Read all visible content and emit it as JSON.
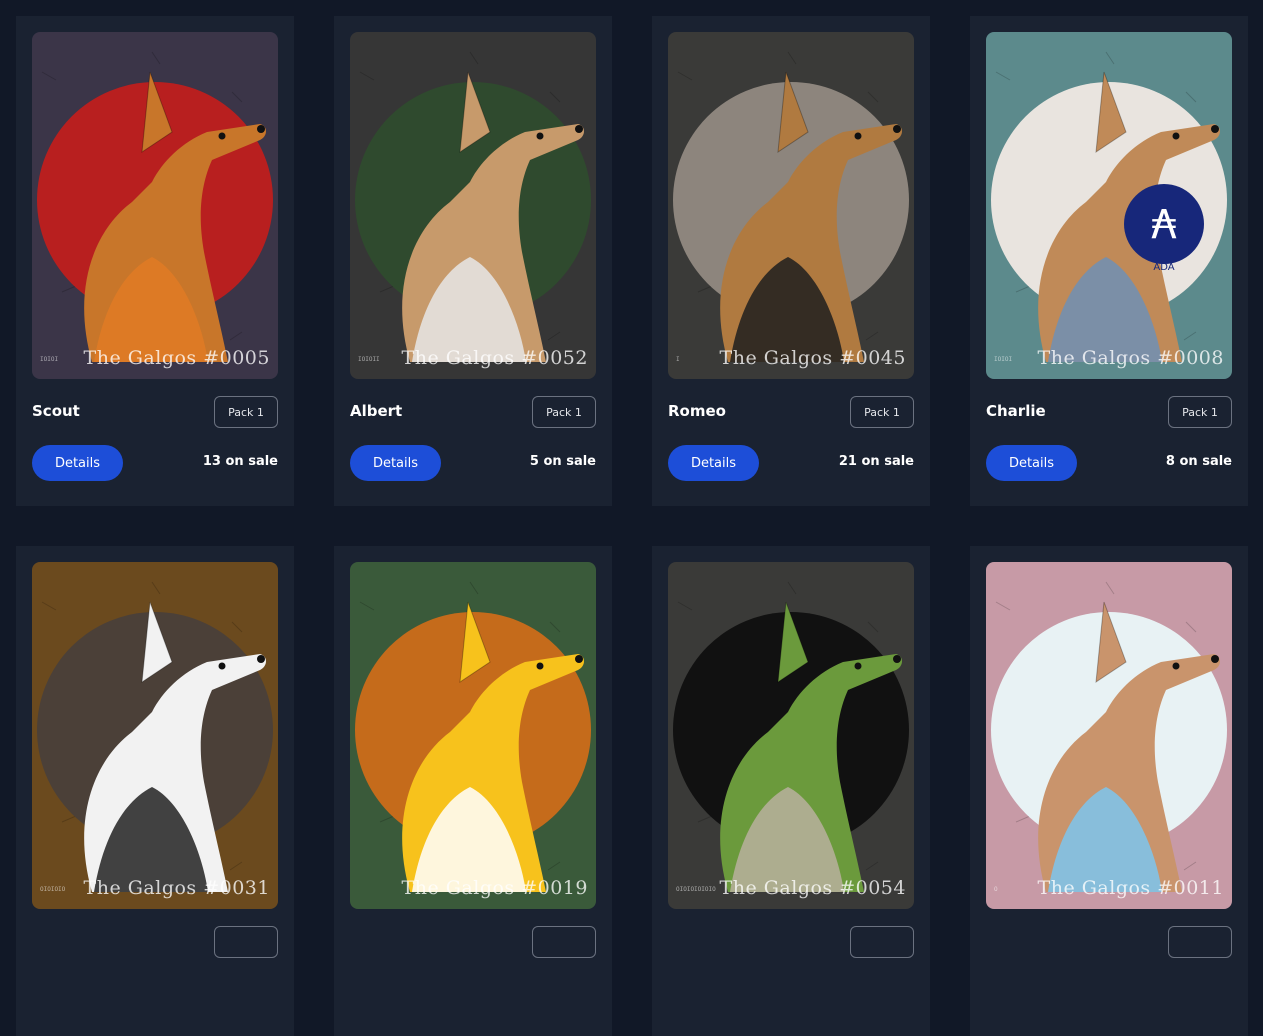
{
  "cards": [
    {
      "name": "Scout",
      "pack": "Pack 1",
      "details": "Details",
      "on_sale": "13 on sale",
      "caption": "The Galgos #0005",
      "serial": "IOIOI",
      "bg": "#3b3548",
      "circle": "#b81f1f",
      "fur": "#c8762a",
      "accent": "#e07b24"
    },
    {
      "name": "Albert",
      "pack": "Pack 1",
      "details": "Details",
      "on_sale": "5 on sale",
      "caption": "The Galgos #0052",
      "serial": "IOIOII",
      "bg": "#363636",
      "circle": "#2f4a2e",
      "fur": "#c79a6b",
      "accent": "#e6e6e6"
    },
    {
      "name": "Romeo",
      "pack": "Pack 1",
      "details": "Details",
      "on_sale": "21 on sale",
      "caption": "The Galgos #0045",
      "serial": "I",
      "bg": "#3a3a38",
      "circle": "#8d857d",
      "fur": "#b07a40",
      "accent": "#1e1e1e"
    },
    {
      "name": "Charlie",
      "pack": "Pack 1",
      "details": "Details",
      "on_sale": "8 on sale",
      "caption": "The Galgos #0008",
      "serial": "IOIOI",
      "bg": "#5c8a8c",
      "circle": "#e9e4df",
      "fur": "#c08a58",
      "accent": "#6f8fb5",
      "badge_text": "ADA"
    },
    {
      "name": "",
      "pack": "",
      "details": "",
      "on_sale": "",
      "caption": "The Galgos #0031",
      "serial": "OIOIOIO",
      "bg": "#6b4a1e",
      "circle": "#4b4038",
      "fur": "#f2f2f2",
      "accent": "#222222"
    },
    {
      "name": "",
      "pack": "",
      "details": "",
      "on_sale": "",
      "caption": "The Galgos #0019",
      "serial": "",
      "bg": "#3a5a3a",
      "circle": "#c56b1b",
      "fur": "#f7c21c",
      "accent": "#ffffff"
    },
    {
      "name": "",
      "pack": "",
      "details": "",
      "on_sale": "",
      "caption": "The Galgos #0054",
      "serial": "OIOIOIOIOIO",
      "bg": "#3a3a38",
      "circle": "#111111",
      "fur": "#6b9a3c",
      "accent": "#b8b09e"
    },
    {
      "name": "",
      "pack": "",
      "details": "",
      "on_sale": "",
      "caption": "The Galgos #0011",
      "serial": "O",
      "bg": "#c79aa6",
      "circle": "#e8f2f4",
      "fur": "#c9946c",
      "accent": "#7cc6ee"
    }
  ]
}
